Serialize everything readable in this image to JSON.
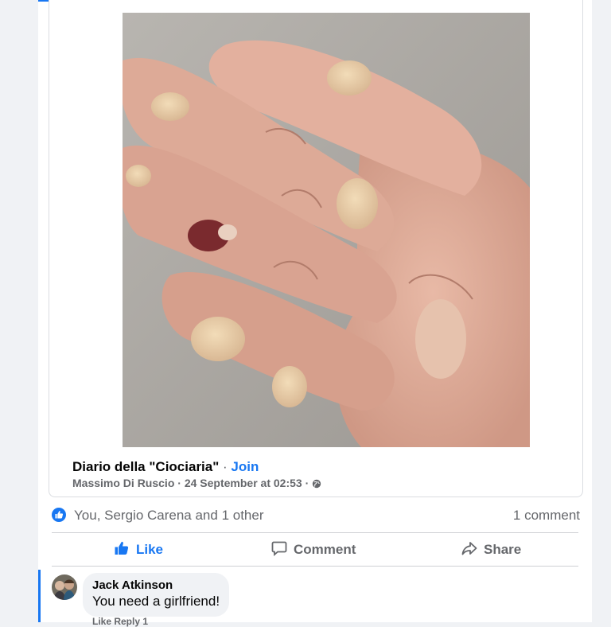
{
  "post": {
    "group_name": "Diario della \"Ciociaria\"",
    "separator": " · ",
    "join_label": "Join",
    "author": "Massimo Di Ruscio",
    "timestamp": "24 September at 02:53",
    "privacy_icon": "globe-icon",
    "photo_subject": "hand-with-blisters-photo"
  },
  "reactions": {
    "summary": "You, Sergio Carena and 1 other",
    "comments_count": "1 comment",
    "icon": "like-badge-icon"
  },
  "actions": {
    "like": "Like",
    "comment": "Comment",
    "share": "Share"
  },
  "comment": {
    "author": "Jack Atkinson",
    "text": "You need a girlfriend!",
    "actions_text": "Like  Reply  1"
  },
  "colors": {
    "accent": "#1877f2",
    "muted": "#65676b",
    "text": "#050505",
    "background": "#f0f2f5"
  }
}
